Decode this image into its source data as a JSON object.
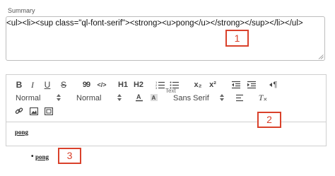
{
  "summary": {
    "label": "Summary",
    "value": "<ul><li><sup class=\"ql-font-serif\"><strong><u>pong</u></strong></sup></li></ul>"
  },
  "markers": {
    "one": "1",
    "two": "2",
    "three": "3"
  },
  "toolbar": {
    "bold": "B",
    "italic": "I",
    "underline": "U",
    "strike": "S",
    "blockquote": "99",
    "code": "</>",
    "h1": "H1",
    "h2": "H2",
    "subscript": "x₂",
    "superscript": "x²",
    "rtl": "¶",
    "header_select": "Normal",
    "size_select": "Normal",
    "font_select": "Sans Serif",
    "tooltip": "Text",
    "clean": "T"
  },
  "editor": {
    "content": "pong"
  },
  "preview": {
    "bullet": "•",
    "content": "pong"
  },
  "colors": {
    "marker": "#d9412b",
    "border": "#cfcfcf"
  }
}
